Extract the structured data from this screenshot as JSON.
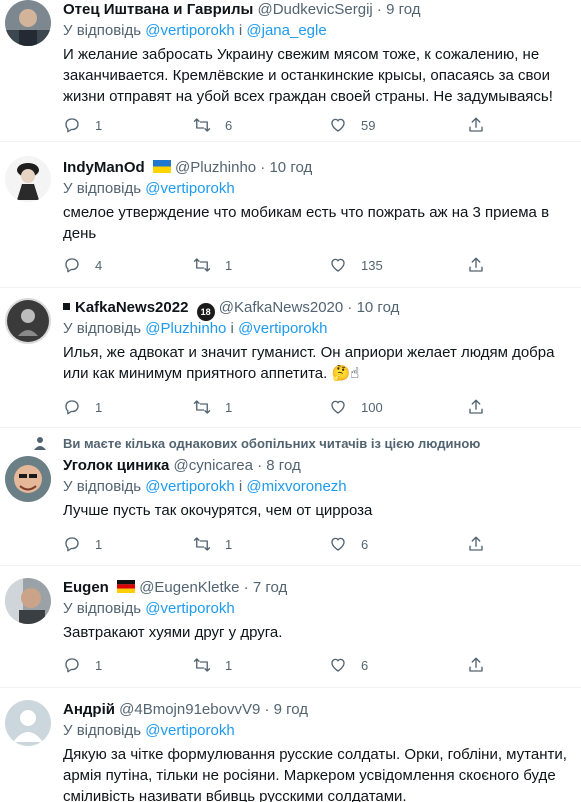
{
  "tweets": [
    {
      "name": "Отец Иштвана и Гаврилы",
      "handle": "@DudkevicSergij",
      "time": "9 год",
      "reply_prefix": "У відповідь",
      "reply_to_1": "@vertiporokh",
      "reply_and": "і",
      "reply_to_2": "@jana_egle",
      "text": "И желание забросать Украину свежим мясом тоже, к сожалению, не заканчивается. Кремлёвские и останкинские крысы, опасаясь за свои жизни отправят на убой всех граждан своей страны. Не задумываясь!",
      "replies": "1",
      "retweets": "6",
      "likes": "59"
    },
    {
      "name": "IndyManOd",
      "handle": "@Pluzhinho",
      "time": "10 год",
      "reply_prefix": "У відповідь",
      "reply_to_1": "@vertiporokh",
      "text": "смелое утверждение что мобикам есть что пожрать аж на 3 приема в день",
      "replies": "4",
      "retweets": "1",
      "likes": "135"
    },
    {
      "name": "KafkaNews2022",
      "badge": "18",
      "handle": "@KafkaNews2020",
      "time": "10 год",
      "reply_prefix": "У відповідь",
      "reply_to_1": "@Pluzhinho",
      "reply_and": "і",
      "reply_to_2": "@vertiporokh",
      "text": "Илья, же адвокат и значит гуманист. Он априори желает людям добра или как минимум приятного аппетита. 🤔☝",
      "replies": "1",
      "retweets": "1",
      "likes": "100"
    },
    {
      "mutual_note": "Ви маєте кілька однакових обопільних читачів із цією людиною",
      "name": "Уголок циника",
      "handle": "@cynicarea",
      "time": "8 год",
      "reply_prefix": "У відповідь",
      "reply_to_1": "@vertiporokh",
      "reply_and": "і",
      "reply_to_2": "@mixvoronezh",
      "text": "Лучше пусть так окочурятся, чем от цирроза",
      "replies": "1",
      "retweets": "1",
      "likes": "6"
    },
    {
      "name": "Eugen",
      "handle": "@EugenKletke",
      "time": "7 год",
      "reply_prefix": "У відповідь",
      "reply_to_1": "@vertiporokh",
      "text": "Завтракают хуями друг у друга.",
      "replies": "1",
      "retweets": "1",
      "likes": "6"
    },
    {
      "name": "Андрій",
      "handle": "@4Bmojn91ebovvV9",
      "time": "9 год",
      "reply_prefix": "У відповідь",
      "reply_to_1": "@vertiporokh",
      "text": "Дякую за чітке формулювання русские солдаты. Орки, гобліни, мутанти, армія путіна, тільки не росіяни. Маркером усвідомлення скоєного буде сміливість називати вбивць русскими солдатами."
    }
  ],
  "separator": "·",
  "icons": [
    "reply-icon",
    "retweet-icon",
    "like-icon",
    "share-icon",
    "person-icon"
  ],
  "colors": {
    "link": "#1d9bf0",
    "secondary": "#536471",
    "text": "#0f1419",
    "divider": "#eff3f4"
  }
}
